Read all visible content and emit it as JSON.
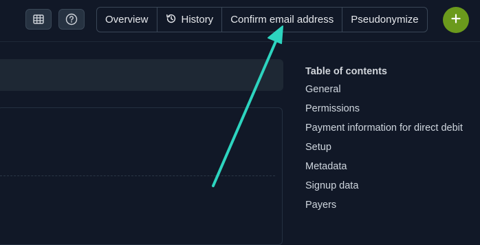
{
  "header": {
    "grid_icon": "table-grid-icon",
    "help_icon": "question-circle-icon",
    "tabs": [
      {
        "label": "Overview"
      },
      {
        "label": "History",
        "icon": "history-icon"
      },
      {
        "label": "Confirm email address"
      },
      {
        "label": "Pseudonymize"
      }
    ],
    "add_icon": "plus-icon"
  },
  "toc": {
    "title": "Table of contents",
    "items": [
      "General",
      "Permissions",
      "Payment information for direct debit",
      "Setup",
      "Metadata",
      "Signup data",
      "Payers"
    ]
  },
  "colors": {
    "background": "#111827",
    "accent_add": "#6b9a1c",
    "annotation_arrow": "#2dd4bf"
  }
}
